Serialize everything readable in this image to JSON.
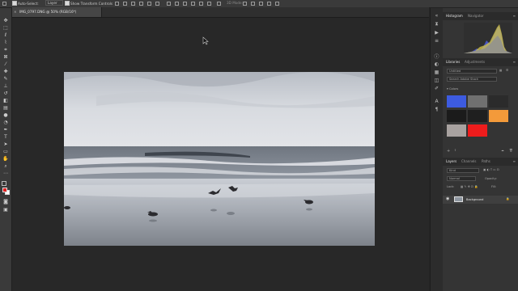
{
  "options_bar": {
    "auto_select_label": "Auto-Select:",
    "auto_select_value": "Layer",
    "transform_controls_label": "Show Transform Controls",
    "mode_3d_label": "3D Mode:"
  },
  "document_tab": {
    "close_glyph": "×",
    "title": "IMG_0797.DNG @ 50% (RGB/16*)"
  },
  "colors": {
    "foreground": "#e31e1e",
    "background": "#ffffff"
  },
  "panels": {
    "histogram": {
      "tabs": [
        "Histogram",
        "Navigator"
      ]
    },
    "libraries": {
      "tabs": [
        "Libraries",
        "Adjustments"
      ],
      "library_select": "Untitled",
      "search_placeholder": "Search Adobe Stock",
      "group_label": "Colors",
      "swatches": [
        "#3d5be0",
        "#707070",
        "#1b1b1b",
        "#1f1f1f",
        "#2b2b2b",
        "#f39a3a",
        "#a8a2a0",
        "#ee1c1c"
      ]
    },
    "layers": {
      "tabs": [
        "Layers",
        "Channels",
        "Paths"
      ],
      "filter_placeholder": "Kind",
      "blend_mode": "Normal",
      "opacity_label": "Opacity:",
      "lock_label": "Lock:",
      "fill_label": "Fill:",
      "layer_name": "Background"
    }
  }
}
